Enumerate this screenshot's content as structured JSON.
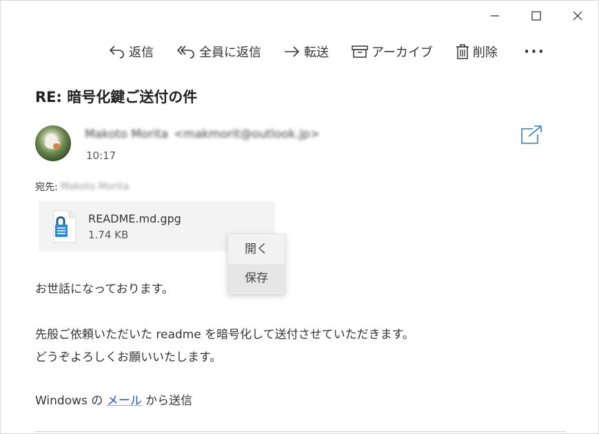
{
  "window": {
    "controls": [
      "minimize-icon",
      "maximize-icon",
      "close-icon"
    ]
  },
  "toolbar": {
    "reply_label": "返信",
    "reply_all_label": "全員に返信",
    "forward_label": "転送",
    "archive_label": "アーカイブ",
    "delete_label": "削除",
    "more_label": "···"
  },
  "message": {
    "subject": "RE: 暗号化鍵ご送付の件",
    "sender_name": "Makoto Morita",
    "sender_email": "<makmorit@outlook.jp>",
    "time": "10:17",
    "to_label": "宛先:",
    "to_name": "Makoto Morita"
  },
  "attachment": {
    "name": "README.md.gpg",
    "size": "1.74 KB"
  },
  "context_menu": {
    "items": [
      {
        "label": "開く"
      },
      {
        "label": "保存"
      }
    ]
  },
  "body": {
    "greeting": "お世話になっております。",
    "line2": "先般ご依頼いただいた readme を暗号化して送付させていただきます。",
    "line3": "どうぞよろしくお願いいたします。",
    "signature_prefix": "Windows の ",
    "signature_link": "メール",
    "signature_suffix": " から送信"
  },
  "colors": {
    "accent": "#2b7cc8",
    "link": "#2b4bd1",
    "attachment_bg": "#f3f3f3"
  }
}
